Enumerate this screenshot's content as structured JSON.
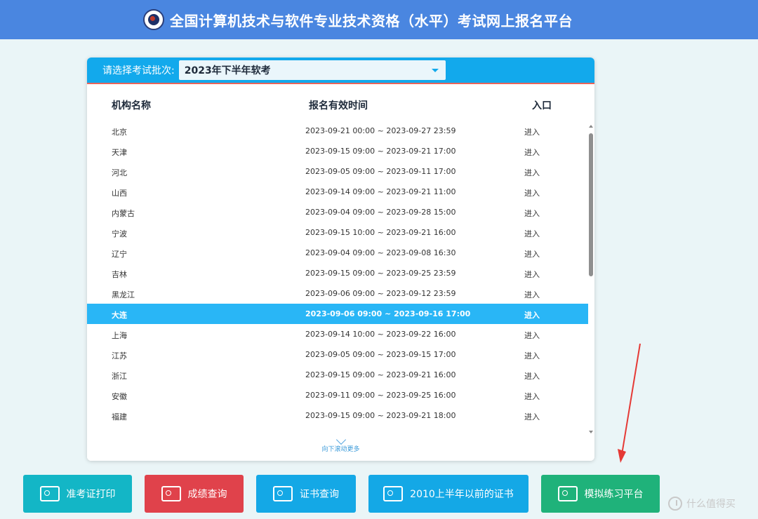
{
  "header": {
    "title": "全国计算机技术与软件专业技术资格（水平）考试网上报名平台",
    "logo_icon": "exam-authority-seal"
  },
  "batch_selector": {
    "label": "请选择考试批次:",
    "selected": "2023年下半年软考",
    "icon": "chevron-down-icon"
  },
  "table": {
    "columns": [
      "机构名称",
      "报名有效时间",
      "入口"
    ],
    "rows": [
      {
        "name": "北京",
        "time": "2023-09-21 00:00 ~ 2023-09-27 23:59",
        "enter": "进入"
      },
      {
        "name": "天津",
        "time": "2023-09-15 09:00 ~ 2023-09-21 17:00",
        "enter": "进入"
      },
      {
        "name": "河北",
        "time": "2023-09-05 09:00 ~ 2023-09-11 17:00",
        "enter": "进入"
      },
      {
        "name": "山西",
        "time": "2023-09-14 09:00 ~ 2023-09-21 11:00",
        "enter": "进入"
      },
      {
        "name": "内蒙古",
        "time": "2023-09-04 09:00 ~ 2023-09-28 15:00",
        "enter": "进入"
      },
      {
        "name": "宁波",
        "time": "2023-09-15 10:00 ~ 2023-09-21 16:00",
        "enter": "进入"
      },
      {
        "name": "辽宁",
        "time": "2023-09-04 09:00 ~ 2023-09-08 16:30",
        "enter": "进入"
      },
      {
        "name": "吉林",
        "time": "2023-09-15 09:00 ~ 2023-09-25 23:59",
        "enter": "进入"
      },
      {
        "name": "黑龙江",
        "time": "2023-09-06 09:00 ~ 2023-09-12 23:59",
        "enter": "进入"
      },
      {
        "name": "大连",
        "time": "2023-09-06 09:00 ~ 2023-09-16 17:00",
        "enter": "进入",
        "highlighted": true
      },
      {
        "name": "上海",
        "time": "2023-09-14 10:00 ~ 2023-09-22 16:00",
        "enter": "进入"
      },
      {
        "name": "江苏",
        "time": "2023-09-05 09:00 ~ 2023-09-15 17:00",
        "enter": "进入"
      },
      {
        "name": "浙江",
        "time": "2023-09-15 09:00 ~ 2023-09-21 16:00",
        "enter": "进入"
      },
      {
        "name": "安徽",
        "time": "2023-09-11 09:00 ~ 2023-09-25 16:00",
        "enter": "进入"
      },
      {
        "name": "福建",
        "time": "2023-09-15 09:00 ~ 2023-09-21 18:00",
        "enter": "进入"
      }
    ],
    "scroll_hint": "向下滚动更多"
  },
  "actions": [
    {
      "label": "准考证打印",
      "icon": "id-card-icon",
      "color": "#13b6c6"
    },
    {
      "label": "成绩查询",
      "icon": "document-search-icon",
      "color": "#e0424b"
    },
    {
      "label": "证书查询",
      "icon": "certificate-search-icon",
      "color": "#14a8e6"
    },
    {
      "label": "2010上半年以前的证书",
      "icon": "certificate-search-icon",
      "color": "#14a8e6"
    },
    {
      "label": "模拟练习平台",
      "icon": "edit-document-icon",
      "color": "#1fb27a"
    }
  ],
  "annotation": {
    "color": "#e53935"
  },
  "watermark": {
    "text": "什么值得买"
  },
  "colors": {
    "header_bg": "#4a86e0",
    "accent": "#12a9ec",
    "highlight_row": "#29b6f6"
  }
}
